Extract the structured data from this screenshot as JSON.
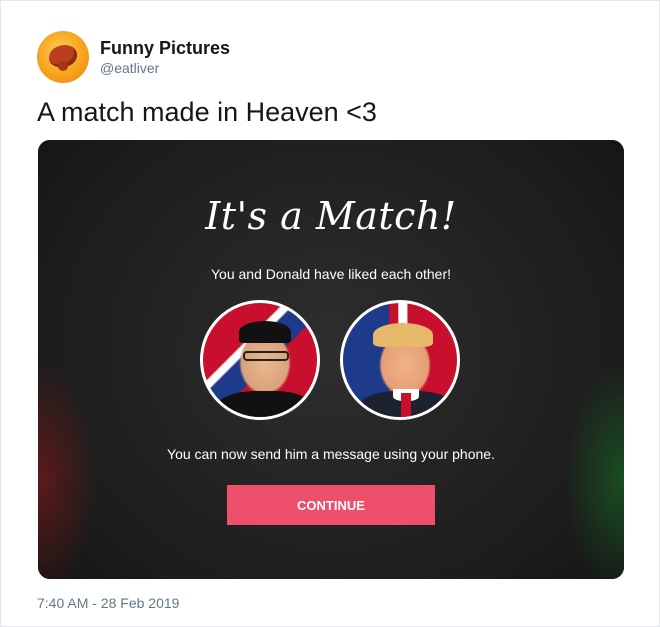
{
  "author": {
    "display_name": "Funny Pictures",
    "handle": "@eatliver",
    "avatar_icon": "liver-icon"
  },
  "tweet": {
    "text": "A match made in Heaven <3",
    "timestamp": "7:40 AM - 28 Feb 2019"
  },
  "media": {
    "title": "It's a Match!",
    "liked_text": "You and Donald have liked each other!",
    "message_text": "You can now send him a message using your phone.",
    "continue_label": "CONTINUE",
    "accent_color": "#ee4f6a"
  }
}
